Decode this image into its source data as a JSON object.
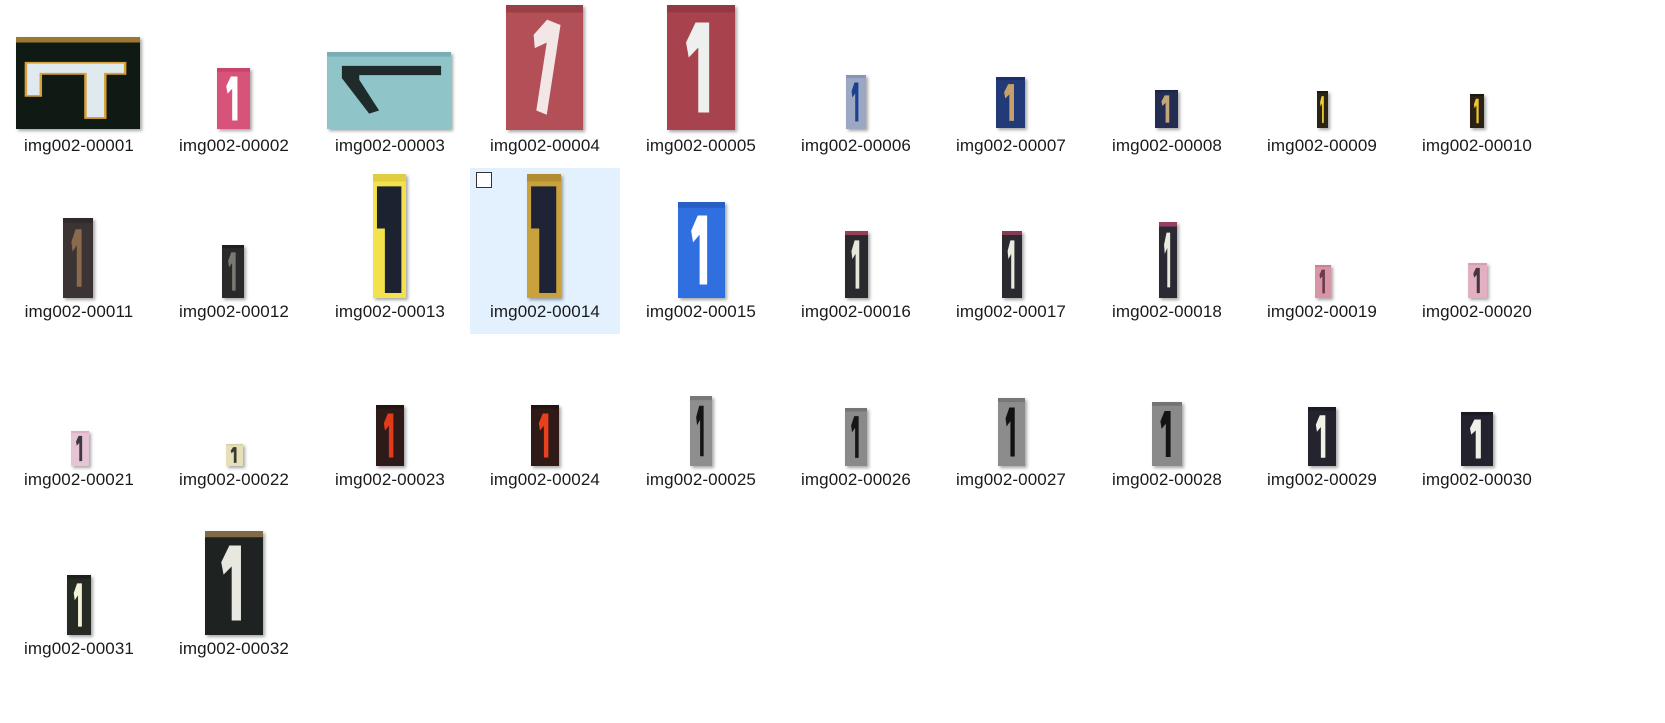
{
  "items": [
    {
      "label": "img002-00001",
      "thumb": "digit-one-thumbnail",
      "bg": "#0f1a14",
      "fg": "#dfe9ee",
      "accent": "#d7a03a",
      "style": "rotated"
    },
    {
      "label": "img002-00002",
      "thumb": "digit-one-thumbnail",
      "bg": "#d8537a",
      "fg": "#ffffff",
      "accent": "#c04066",
      "style": "plain"
    },
    {
      "label": "img002-00003",
      "thumb": "digit-one-thumbnail",
      "bg": "#8fc4c8",
      "fg": "#1f2a2a",
      "accent": "#6fa7ab",
      "style": "rotated-dark"
    },
    {
      "label": "img002-00004",
      "thumb": "digit-one-thumbnail",
      "bg": "#b24f57",
      "fg": "#f2e6e6",
      "accent": "#8f3a3f",
      "style": "tilt"
    },
    {
      "label": "img002-00005",
      "thumb": "digit-one-thumbnail",
      "bg": "#a8434d",
      "fg": "#eef0f0",
      "accent": "#8c343d",
      "style": "plain"
    },
    {
      "label": "img002-00006",
      "thumb": "digit-one-thumbnail",
      "bg": "#9aa8c4",
      "fg": "#1e3f8f",
      "accent": "#7f8fb0",
      "style": "plain"
    },
    {
      "label": "img002-00007",
      "thumb": "digit-one-thumbnail",
      "bg": "#233a78",
      "fg": "#c8a06a",
      "accent": "#1a2c60",
      "style": "plain"
    },
    {
      "label": "img002-00008",
      "thumb": "digit-one-thumbnail",
      "bg": "#232d52",
      "fg": "#c2a57a",
      "accent": "#1b2443",
      "style": "plain"
    },
    {
      "label": "img002-00009",
      "thumb": "digit-one-thumbnail",
      "bg": "#2a2418",
      "fg": "#f0cc2f",
      "accent": "#1b170e",
      "style": "plain"
    },
    {
      "label": "img002-00010",
      "thumb": "digit-one-thumbnail",
      "bg": "#2a2214",
      "fg": "#f1c52d",
      "accent": "#1a150b",
      "style": "plain"
    },
    {
      "label": "img002-00011",
      "thumb": "digit-one-thumbnail",
      "bg": "#3c3434",
      "fg": "#8a6a4c",
      "accent": "#2d2626",
      "style": "plain"
    },
    {
      "label": "img002-00012",
      "thumb": "digit-one-thumbnail",
      "bg": "#2a2a2a",
      "fg": "#7a7a72",
      "accent": "#1c1c1c",
      "style": "plain"
    },
    {
      "label": "img002-00013",
      "thumb": "digit-one-thumbnail",
      "bg": "#f3e24b",
      "fg": "#1d2230",
      "accent": "#d8c43c",
      "style": "tall"
    },
    {
      "label": "img002-00014",
      "thumb": "digit-one-thumbnail",
      "bg": "#c9a23c",
      "fg": "#1e2436",
      "accent": "#a8852c",
      "style": "tall"
    },
    {
      "label": "img002-00015",
      "thumb": "digit-one-thumbnail",
      "bg": "#2f6fe0",
      "fg": "#ffffff",
      "accent": "#2458b8",
      "style": "plain"
    },
    {
      "label": "img002-00016",
      "thumb": "digit-one-thumbnail",
      "bg": "#2a2a2e",
      "fg": "#e6e6dc",
      "accent": "#c24b6a",
      "style": "plain"
    },
    {
      "label": "img002-00017",
      "thumb": "digit-one-thumbnail",
      "bg": "#2b2a30",
      "fg": "#ebebe0",
      "accent": "#b0426a",
      "style": "plain"
    },
    {
      "label": "img002-00018",
      "thumb": "digit-one-thumbnail",
      "bg": "#2b2a33",
      "fg": "#ececde",
      "accent": "#c44a78",
      "style": "plain"
    },
    {
      "label": "img002-00019",
      "thumb": "digit-one-thumbnail",
      "bg": "#d895a6",
      "fg": "#6b3b4b",
      "accent": "#c17b8e",
      "style": "plain"
    },
    {
      "label": "img002-00020",
      "thumb": "digit-one-thumbnail",
      "bg": "#e2b0c0",
      "fg": "#4a3444",
      "accent": "#cf98aa",
      "style": "plain"
    },
    {
      "label": "img002-00021",
      "thumb": "digit-one-thumbnail",
      "bg": "#e6c4d6",
      "fg": "#3d3842",
      "accent": "#d4a9bf",
      "style": "plain"
    },
    {
      "label": "img002-00022",
      "thumb": "digit-one-thumbnail",
      "bg": "#e6e0b8",
      "fg": "#3a3a30",
      "accent": "#cfc79d",
      "style": "plain"
    },
    {
      "label": "img002-00023",
      "thumb": "digit-one-thumbnail",
      "bg": "#2e1a18",
      "fg": "#e23a1a",
      "accent": "#201110",
      "style": "plain"
    },
    {
      "label": "img002-00024",
      "thumb": "digit-one-thumbnail",
      "bg": "#301a18",
      "fg": "#e8401e",
      "accent": "#211110",
      "style": "plain"
    },
    {
      "label": "img002-00025",
      "thumb": "digit-one-thumbnail",
      "bg": "#8e8e8e",
      "fg": "#141414",
      "accent": "#6f6f6f",
      "style": "plain"
    },
    {
      "label": "img002-00026",
      "thumb": "digit-one-thumbnail",
      "bg": "#8a8a8a",
      "fg": "#161616",
      "accent": "#6c6c6c",
      "style": "plain"
    },
    {
      "label": "img002-00027",
      "thumb": "digit-one-thumbnail",
      "bg": "#8c8c8c",
      "fg": "#121212",
      "accent": "#6d6d6d",
      "style": "plain"
    },
    {
      "label": "img002-00028",
      "thumb": "digit-one-thumbnail",
      "bg": "#8a8a8a",
      "fg": "#141414",
      "accent": "#6b6b6b",
      "style": "plain"
    },
    {
      "label": "img002-00029",
      "thumb": "digit-one-thumbnail",
      "bg": "#23242e",
      "fg": "#f2f2e6",
      "accent": "#181920",
      "style": "plain"
    },
    {
      "label": "img002-00030",
      "thumb": "digit-one-thumbnail",
      "bg": "#24222e",
      "fg": "#f0f0e8",
      "accent": "#171621",
      "style": "plain"
    },
    {
      "label": "img002-00031",
      "thumb": "digit-one-thumbnail",
      "bg": "#262a24",
      "fg": "#f2f2d8",
      "accent": "#191c17",
      "style": "plain"
    },
    {
      "label": "img002-00032",
      "thumb": "digit-one-thumbnail",
      "bg": "#1e2322",
      "fg": "#e8e8e0",
      "accent": "#a98a5a",
      "style": "plain"
    }
  ],
  "selected_label": "img002-00014"
}
